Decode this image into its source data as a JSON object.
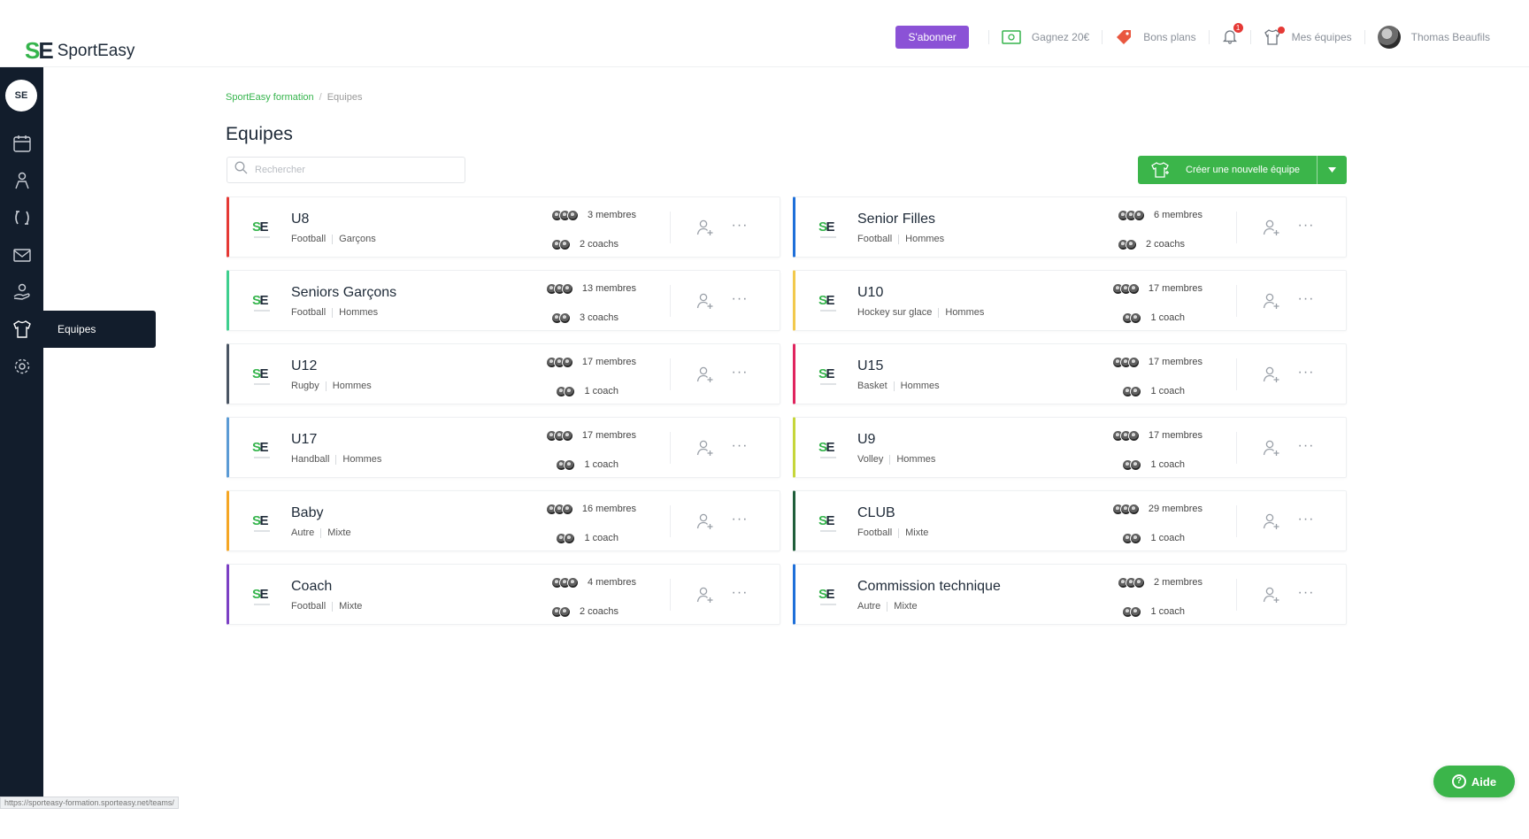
{
  "app": {
    "name": "SportEasy",
    "logo_mark": "SE"
  },
  "topnav": {
    "subscribe": "S'abonner",
    "referral": "Gagnez 20€",
    "deals": "Bons plans",
    "notifications_count": "1",
    "my_teams": "Mes équipes",
    "user_name": "Thomas Beaufils"
  },
  "sidebar": {
    "logo": "SE",
    "tooltip": "Equipes"
  },
  "breadcrumb": {
    "root": "SportEasy formation",
    "current": "Equipes"
  },
  "page": {
    "title": "Equipes",
    "search_placeholder": "Rechercher",
    "create_button": "Créer une nouvelle équipe"
  },
  "colors": {
    "brand_green": "#3bb54a",
    "subscribe_purple": "#8b52d6",
    "sidebar_bg": "#121d2c"
  },
  "teams": [
    {
      "name": "U8",
      "sport": "Football",
      "gender": "Garçons",
      "members": "3 membres",
      "coaches": "2 coachs",
      "accent": "#e53935"
    },
    {
      "name": "Senior Filles",
      "sport": "Football",
      "gender": "Hommes",
      "members": "6 membres",
      "coaches": "2 coachs",
      "accent": "#1e6fd9"
    },
    {
      "name": "Seniors Garçons",
      "sport": "Football",
      "gender": "Hommes",
      "members": "13 membres",
      "coaches": "3 coachs",
      "accent": "#3ecf8e"
    },
    {
      "name": "U10",
      "sport": "Hockey sur glace",
      "gender": "Hommes",
      "members": "17 membres",
      "coaches": "1 coach",
      "accent": "#f2c94c"
    },
    {
      "name": "U12",
      "sport": "Rugby",
      "gender": "Hommes",
      "members": "17 membres",
      "coaches": "1 coach",
      "accent": "#4a5563"
    },
    {
      "name": "U15",
      "sport": "Basket",
      "gender": "Hommes",
      "members": "17 membres",
      "coaches": "1 coach",
      "accent": "#e0245e"
    },
    {
      "name": "U17",
      "sport": "Handball",
      "gender": "Hommes",
      "members": "17 membres",
      "coaches": "1 coach",
      "accent": "#5b9bd5"
    },
    {
      "name": "U9",
      "sport": "Volley",
      "gender": "Hommes",
      "members": "17 membres",
      "coaches": "1 coach",
      "accent": "#c6d63a"
    },
    {
      "name": "Baby",
      "sport": "Autre",
      "gender": "Mixte",
      "members": "16 membres",
      "coaches": "1 coach",
      "accent": "#f5a623"
    },
    {
      "name": "CLUB",
      "sport": "Football",
      "gender": "Mixte",
      "members": "29 membres",
      "coaches": "1 coach",
      "accent": "#1f5e3a"
    },
    {
      "name": "Coach",
      "sport": "Football",
      "gender": "Mixte",
      "members": "4 membres",
      "coaches": "2 coachs",
      "accent": "#7b3fc4"
    },
    {
      "name": "Commission technique",
      "sport": "Autre",
      "gender": "Mixte",
      "members": "2 membres",
      "coaches": "1 coach",
      "accent": "#1e6fd9"
    }
  ],
  "status_url": "https://sporteasy-formation.sporteasy.net/teams/",
  "help": {
    "label": "Aide"
  }
}
